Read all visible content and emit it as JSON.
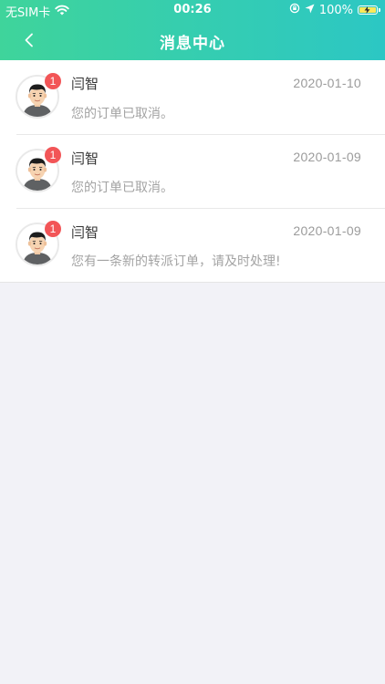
{
  "status_bar": {
    "carrier": "无SIM卡",
    "time": "00:26",
    "battery": "100%"
  },
  "nav": {
    "title": "消息中心"
  },
  "messages": [
    {
      "sender": "闫智",
      "date": "2020-01-10",
      "preview": "您的订单已取消。",
      "badge": "1"
    },
    {
      "sender": "闫智",
      "date": "2020-01-09",
      "preview": "您的订单已取消。",
      "badge": "1"
    },
    {
      "sender": "闫智",
      "date": "2020-01-09",
      "preview": "您有一条新的转派订单，请及时处理!",
      "badge": "1"
    }
  ],
  "colors": {
    "header_start": "#3fd49b",
    "header_end": "#2cc7c4",
    "badge": "#f25557",
    "background": "#f2f2f7"
  }
}
